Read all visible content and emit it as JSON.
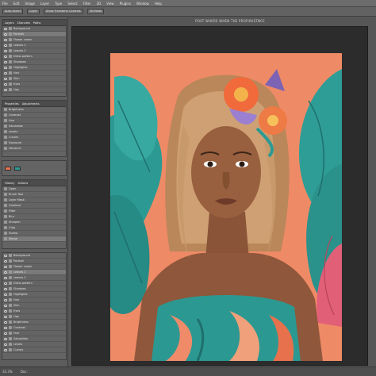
{
  "menubar": {
    "items": [
      "File",
      "Edit",
      "Image",
      "Layer",
      "Type",
      "Select",
      "Filter",
      "3D",
      "View",
      "Plugins",
      "Window",
      "Help"
    ]
  },
  "optionsbar": {
    "items": [
      "Auto-Select",
      "Layer",
      "Show Transform Controls",
      "3D Mode"
    ]
  },
  "document": {
    "title": "POST WHERE WHEN THE PROFIRASTNCE"
  },
  "layers_panel": {
    "header_labels": [
      "Layers",
      "Channels",
      "Paths"
    ],
    "rows": [
      "Background",
      "Portrait",
      "Flower crown",
      "Leaves 1",
      "Leaves 2",
      "Dress pattern",
      "Shadows",
      "Highlights",
      "Hair",
      "Skin",
      "Eyes",
      "Lips"
    ]
  },
  "adjust_panel": {
    "header_labels": [
      "Properties",
      "Adjustments"
    ],
    "rows": [
      "Brightness",
      "Contrast",
      "Hue",
      "Saturation",
      "Levels",
      "Curves",
      "Exposure",
      "Vibrance"
    ]
  },
  "history_panel": {
    "header_labels": [
      "History",
      "Actions"
    ],
    "rows": [
      "Open",
      "Brush Tool",
      "Layer Mask",
      "Gradient",
      "Filter",
      "Blur",
      "Sharpen",
      "Crop",
      "Stamp",
      "Merge"
    ]
  },
  "colors": {
    "foreground": "#e8714d",
    "background": "#2b9b94"
  },
  "status": {
    "zoom": "33.3%",
    "doc": "Doc:"
  }
}
